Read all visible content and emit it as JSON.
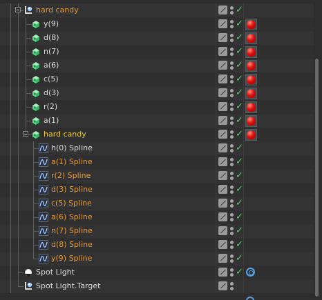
{
  "panel": {
    "rows": [
      {
        "label": "hard candy",
        "color": "orange",
        "icon": "null-object-icon",
        "level": 0,
        "fold": true,
        "tag": "none"
      },
      {
        "label": "y(9)",
        "color": "white",
        "icon": "extrude-object-icon",
        "level": 1,
        "tag": "material"
      },
      {
        "label": "d(8)",
        "color": "white",
        "icon": "extrude-object-icon",
        "level": 1,
        "tag": "material"
      },
      {
        "label": "n(7)",
        "color": "white",
        "icon": "extrude-object-icon",
        "level": 1,
        "tag": "material"
      },
      {
        "label": "a(6)",
        "color": "white",
        "icon": "extrude-object-icon",
        "level": 1,
        "tag": "material"
      },
      {
        "label": "c(5)",
        "color": "white",
        "icon": "extrude-object-icon",
        "level": 1,
        "tag": "material"
      },
      {
        "label": "d(3)",
        "color": "white",
        "icon": "extrude-object-icon",
        "level": 1,
        "tag": "material"
      },
      {
        "label": "r(2)",
        "color": "white",
        "icon": "extrude-object-icon",
        "level": 1,
        "tag": "material"
      },
      {
        "label": "a(1)",
        "color": "white",
        "icon": "extrude-object-icon",
        "level": 1,
        "tag": "material"
      },
      {
        "label": "hard candy",
        "color": "yellow",
        "icon": "extrude-object-icon",
        "level": 1,
        "fold": true,
        "tag": "material"
      },
      {
        "label": "h(0) Spline",
        "color": "white",
        "icon": "spline-icon",
        "level": 2,
        "tag": "none"
      },
      {
        "label": "a(1) Spline",
        "color": "orange",
        "icon": "spline-icon",
        "level": 2,
        "tag": "none"
      },
      {
        "label": "r(2) Spline",
        "color": "orange",
        "icon": "spline-icon",
        "level": 2,
        "tag": "none"
      },
      {
        "label": "d(3) Spline",
        "color": "orange",
        "icon": "spline-icon",
        "level": 2,
        "tag": "none"
      },
      {
        "label": "c(5) Spline",
        "color": "orange",
        "icon": "spline-icon",
        "level": 2,
        "tag": "none"
      },
      {
        "label": "a(6) Spline",
        "color": "orange",
        "icon": "spline-icon",
        "level": 2,
        "tag": "none"
      },
      {
        "label": "n(7) Spline",
        "color": "orange",
        "icon": "spline-icon",
        "level": 2,
        "tag": "none"
      },
      {
        "label": "d(8) Spline",
        "color": "orange",
        "icon": "spline-icon",
        "level": 2,
        "tag": "none"
      },
      {
        "label": "y(9) Spline",
        "color": "orange",
        "icon": "spline-icon",
        "level": 2,
        "tag": "none"
      },
      {
        "label": "Spot Light",
        "color": "white",
        "icon": "spot-light-icon",
        "level": 0,
        "tag": "target"
      },
      {
        "label": "Spot Light.Target",
        "color": "white",
        "icon": "null-object-icon",
        "level": 0,
        "tag": "none"
      }
    ]
  },
  "colors": {
    "accent_orange": "#e39a3c",
    "selected_yellow": "#f0c83c",
    "check_green": "#56d06c",
    "material_red": "#e01010",
    "target_blue": "#5aa0e0"
  }
}
